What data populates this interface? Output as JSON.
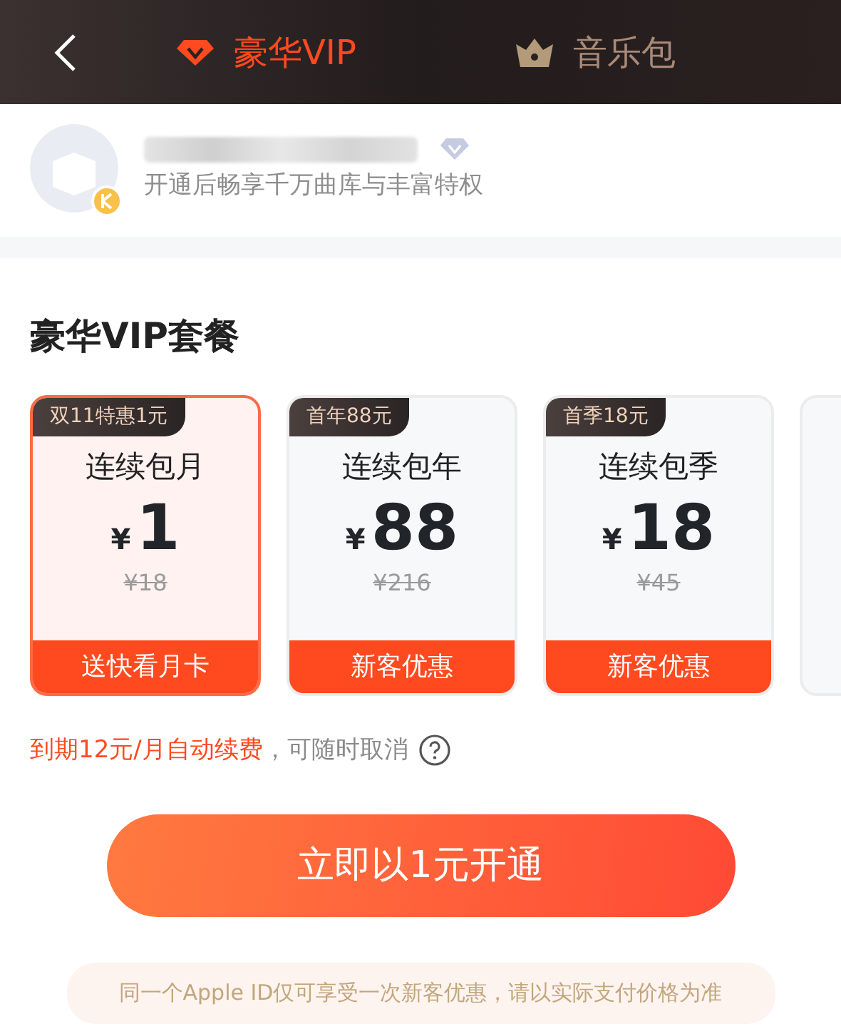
{
  "header": {
    "tabs": [
      {
        "label": "豪华VIP",
        "kind": "vip",
        "selected": true
      },
      {
        "label": "音乐包",
        "kind": "music",
        "selected": false
      }
    ]
  },
  "profile": {
    "subtitle": "开通后畅享千万曲库与丰富特权"
  },
  "plans_section": {
    "title": "豪华VIP套餐",
    "plans": [
      {
        "tag": "双11特惠1元",
        "name": "连续包月",
        "currency": "¥",
        "price": "1",
        "original_price": "¥18",
        "footer": "送快看月卡",
        "selected": true
      },
      {
        "tag": "首年88元",
        "name": "连续包年",
        "currency": "¥",
        "price": "88",
        "original_price": "¥216",
        "footer": "新客优惠",
        "selected": false
      },
      {
        "tag": "首季18元",
        "name": "连续包季",
        "currency": "¥",
        "price": "18",
        "original_price": "¥45",
        "footer": "新客优惠",
        "selected": false
      }
    ],
    "renewal_note": "到期12元/月自动续费",
    "cancel_note": "，可随时取消"
  },
  "subscribe_button": "立即以1元开通",
  "disclaimer": "同一个Apple ID仅可享受一次新客优惠，请以实际支付价格为准"
}
